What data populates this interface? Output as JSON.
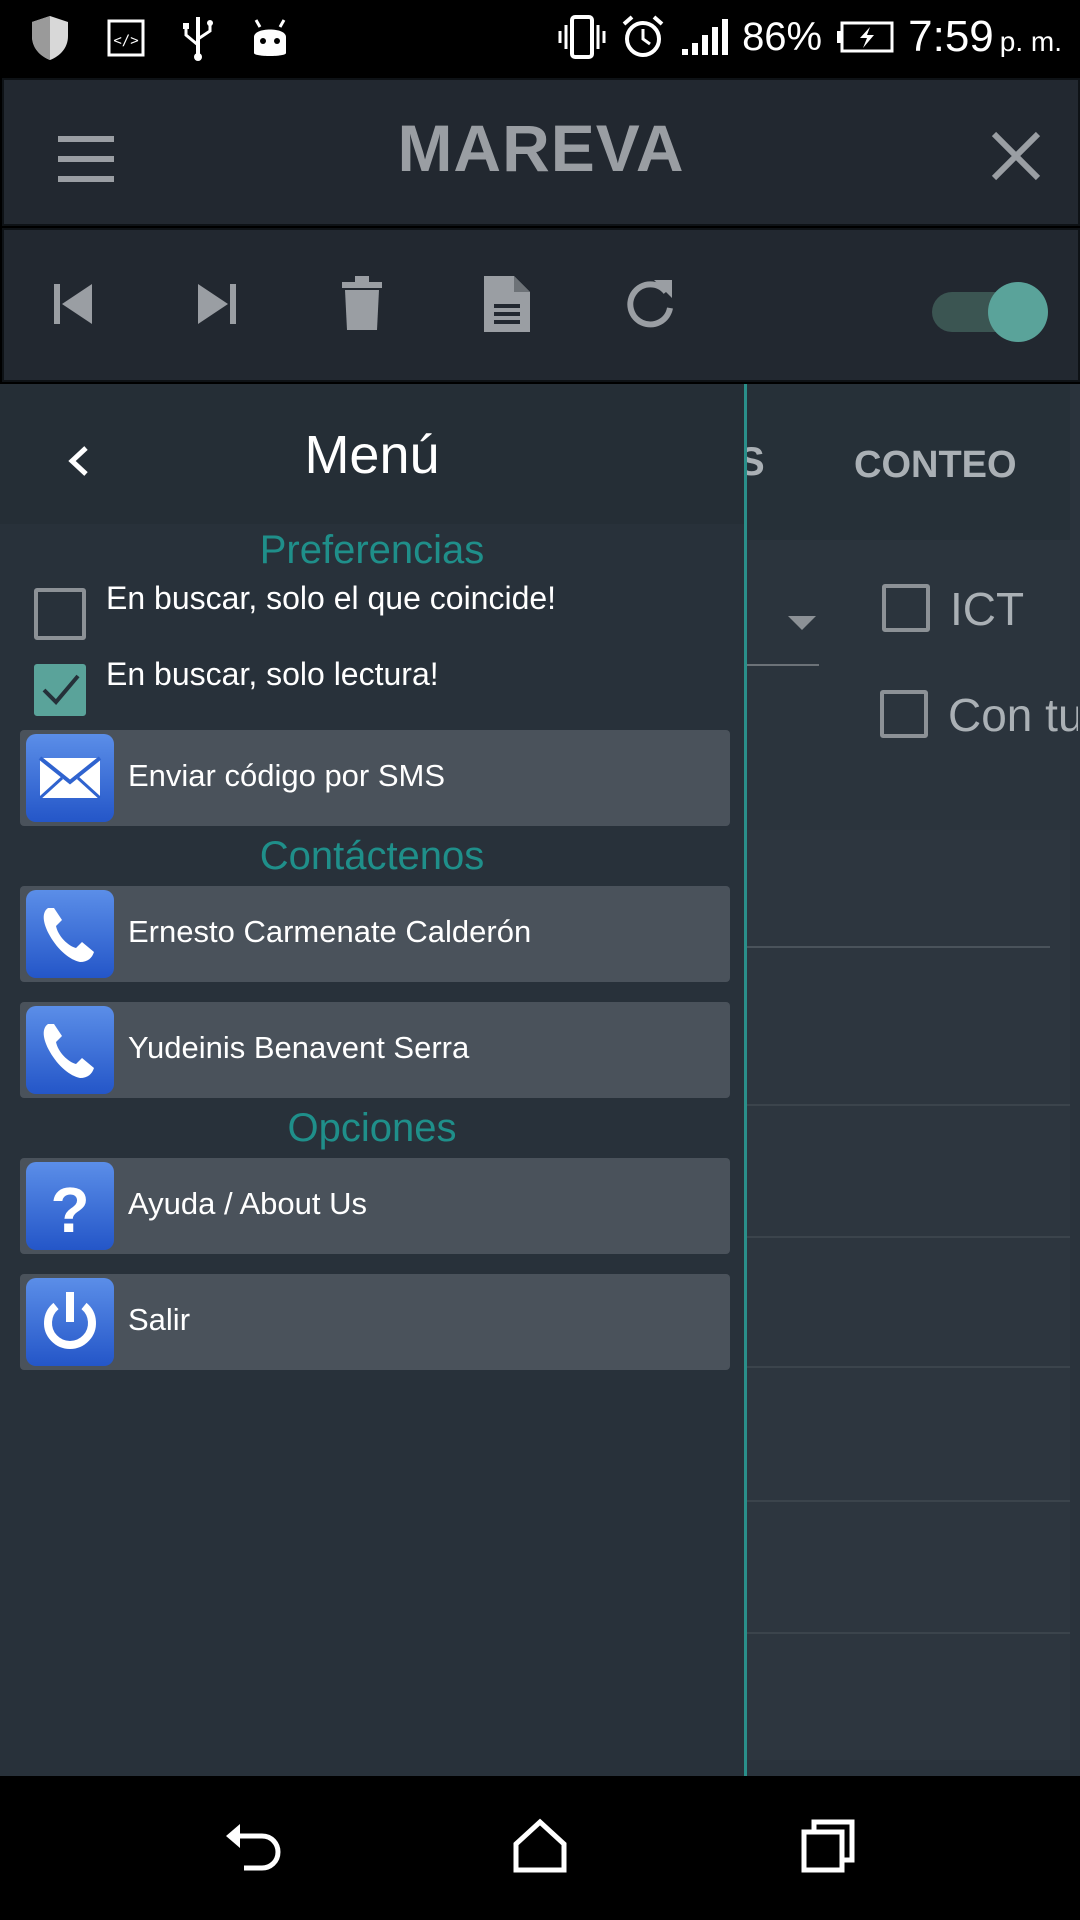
{
  "status_bar": {
    "battery_percent": "86%",
    "time": "7:59",
    "time_suffix": "p. m.",
    "icons": [
      "shield-icon",
      "code-icon",
      "usb-icon",
      "android-icon",
      "vibrate-icon",
      "alarm-icon",
      "signal-icon",
      "battery-charging-icon"
    ]
  },
  "app_bar": {
    "title": "MAREVA",
    "menu_icon": "hamburger-icon",
    "close_icon": "close-icon"
  },
  "toolbar": {
    "icons": [
      "skip-previous-icon",
      "skip-next-icon",
      "trash-icon",
      "document-icon",
      "refresh-icon"
    ],
    "toggle_on": true
  },
  "background": {
    "tab_partial": "S",
    "tab_conteo": "CONTEO",
    "checkbox_1_label": "ICT",
    "checkbox_2_label": "Con tu"
  },
  "drawer": {
    "title": "Menú",
    "sections": {
      "preferences": "Preferencias",
      "contact": "Contáctenos",
      "options": "Opciones"
    },
    "checkboxes": [
      {
        "label": "En buscar, solo el que coincide!",
        "checked": false
      },
      {
        "label": "En buscar, solo lectura!",
        "checked": true
      }
    ],
    "items": {
      "sms": {
        "label": "Enviar código por SMS",
        "icon": "envelope-icon"
      },
      "contact1": {
        "label": "Ernesto Carmenate Calderón",
        "icon": "phone-icon"
      },
      "contact2": {
        "label": "Yudeinis Benavent Serra",
        "icon": "phone-icon"
      },
      "help": {
        "label": "Ayuda / About Us",
        "icon": "help-icon"
      },
      "exit": {
        "label": "Salir",
        "icon": "power-icon"
      }
    }
  },
  "colors": {
    "accent": "#1f8f8a",
    "toggle": "#5aa39a",
    "icon_blue": "#3a6fd8"
  }
}
